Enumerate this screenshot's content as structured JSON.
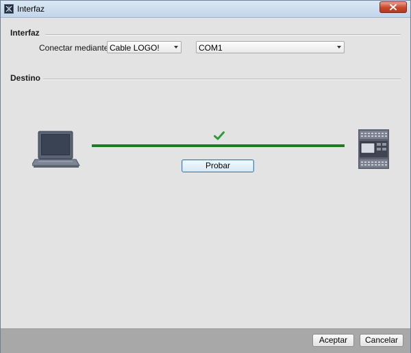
{
  "window": {
    "title": "Interfaz",
    "app_icon": "logo-app-icon",
    "close_icon": "close-icon"
  },
  "interfaz_section": {
    "title": "Interfaz",
    "connect_label": "Conectar mediante:",
    "connection_combo": {
      "value": "Cable LOGO!"
    },
    "port_combo": {
      "value": "COM1"
    }
  },
  "destino_section": {
    "title": "Destino",
    "source_icon": "laptop-icon",
    "target_icon": "plc-module-icon",
    "status_icon": "checkmark-icon",
    "test_button": "Probar"
  },
  "footer": {
    "accept_button": "Aceptar",
    "cancel_button": "Cancelar"
  },
  "colors": {
    "connection_line": "#1f7a25",
    "check": "#2e9b3a",
    "close_button": "#c8482b"
  }
}
